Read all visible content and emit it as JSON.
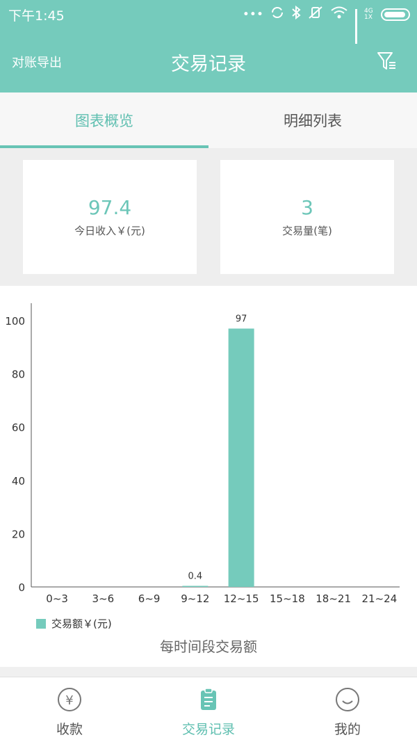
{
  "status_bar": {
    "time": "下午1:45",
    "dots": "•••",
    "network": "4G 1X"
  },
  "header": {
    "left_action": "对账导出",
    "title": "交易记录",
    "filter_icon": "filter-icon"
  },
  "tabs": [
    {
      "label": "图表概览",
      "active": true
    },
    {
      "label": "明细列表",
      "active": false
    }
  ],
  "stats": {
    "income": {
      "value": "97.4",
      "label": "今日收入￥(元)"
    },
    "count": {
      "value": "3",
      "label": "交易量(笔)"
    }
  },
  "chart_data": {
    "type": "bar",
    "categories": [
      "0~3",
      "3~6",
      "6~9",
      "9~12",
      "12~15",
      "15~18",
      "18~21",
      "21~24"
    ],
    "series": [
      {
        "name": "交易额￥(元)",
        "values": [
          0,
          0,
          0,
          0.4,
          97,
          0,
          0,
          0
        ]
      }
    ],
    "data_labels": {
      "3": "0.4",
      "4": "97"
    },
    "ylim": [
      0,
      100
    ],
    "yticks": [
      0,
      20,
      40,
      60,
      80,
      100
    ],
    "description": "每时间段交易额",
    "grid": false,
    "legend_position": "bottom-left",
    "color": "#75cbbc"
  },
  "bottom_nav": [
    {
      "label": "收款",
      "icon": "yuan-circle-icon",
      "active": false
    },
    {
      "label": "交易记录",
      "icon": "clipboard-icon",
      "active": true
    },
    {
      "label": "我的",
      "icon": "smiley-icon",
      "active": false
    }
  ],
  "colors": {
    "primary": "#75cbbc",
    "accent_text": "#5fbfb0"
  }
}
